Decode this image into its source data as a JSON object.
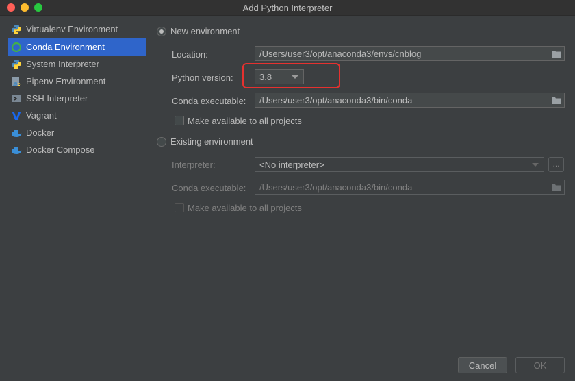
{
  "window": {
    "title": "Add Python Interpreter"
  },
  "sidebar": {
    "items": [
      {
        "label": "Virtualenv Environment",
        "icon": "python-icon"
      },
      {
        "label": "Conda Environment",
        "icon": "conda-icon",
        "selected": true
      },
      {
        "label": "System Interpreter",
        "icon": "python-icon"
      },
      {
        "label": "Pipenv Environment",
        "icon": "pipenv-icon"
      },
      {
        "label": "SSH Interpreter",
        "icon": "ssh-icon"
      },
      {
        "label": "Vagrant",
        "icon": "vagrant-icon"
      },
      {
        "label": "Docker",
        "icon": "docker-icon"
      },
      {
        "label": "Docker Compose",
        "icon": "docker-icon"
      }
    ]
  },
  "new_env": {
    "radio_label": "New environment",
    "location_label": "Location:",
    "location_value": "/Users/user3/opt/anaconda3/envs/cnblog",
    "python_version_label": "Python version:",
    "python_version_value": "3.8",
    "conda_exec_label": "Conda executable:",
    "conda_exec_value": "/Users/user3/opt/anaconda3/bin/conda",
    "make_available_label": "Make available to all projects"
  },
  "existing_env": {
    "radio_label": "Existing environment",
    "interpreter_label": "Interpreter:",
    "interpreter_value": "<No interpreter>",
    "browse_label": "...",
    "conda_exec_label": "Conda executable:",
    "conda_exec_value": "/Users/user3/opt/anaconda3/bin/conda",
    "make_available_label": "Make available to all projects"
  },
  "footer": {
    "cancel_label": "Cancel",
    "ok_label": "OK"
  },
  "colors": {
    "accent": "#2f65ca",
    "highlight": "#e5312f",
    "background": "#3c3f41"
  }
}
